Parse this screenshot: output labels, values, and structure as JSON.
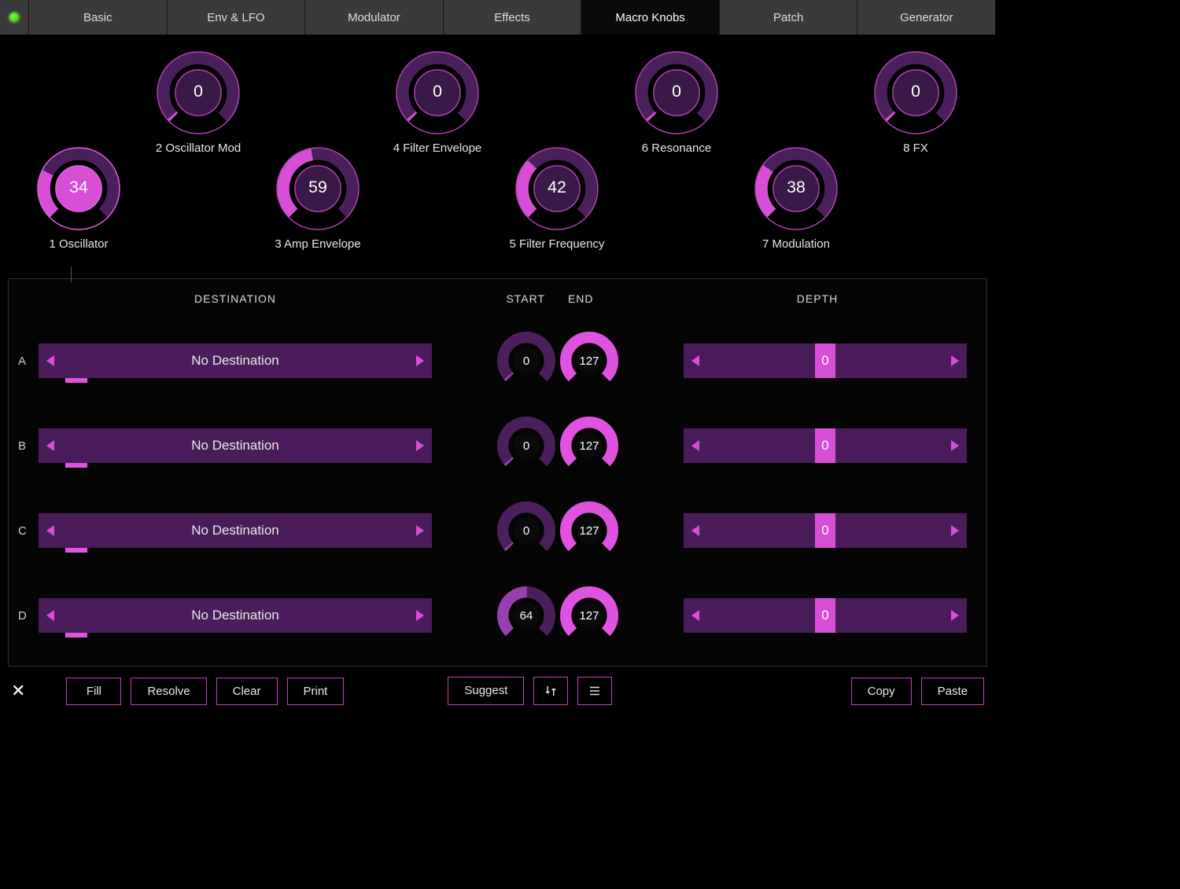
{
  "tabs": {
    "items": [
      "Basic",
      "Env & LFO",
      "Modulator",
      "Effects",
      "Macro Knobs",
      "Patch",
      "Generator"
    ],
    "active_index": 4
  },
  "knobs": [
    {
      "index": 1,
      "label": "1 Oscillator",
      "value": 34,
      "row": "bottom",
      "col": 0,
      "active": true
    },
    {
      "index": 2,
      "label": "2 Oscillator Mod",
      "value": 0,
      "row": "top",
      "col": 1
    },
    {
      "index": 3,
      "label": "3 Amp Envelope",
      "value": 59,
      "row": "bottom",
      "col": 2
    },
    {
      "index": 4,
      "label": "4 Filter Envelope",
      "value": 0,
      "row": "top",
      "col": 3
    },
    {
      "index": 5,
      "label": "5 Filter Frequency",
      "value": 42,
      "row": "bottom",
      "col": 4
    },
    {
      "index": 6,
      "label": "6 Resonance",
      "value": 0,
      "row": "top",
      "col": 5
    },
    {
      "index": 7,
      "label": "7 Modulation",
      "value": 38,
      "row": "bottom",
      "col": 6
    },
    {
      "index": 8,
      "label": "8 FX",
      "value": 0,
      "row": "top",
      "col": 7
    }
  ],
  "dest_headers": {
    "dest": "DESTINATION",
    "start": "START",
    "end": "END",
    "depth": "DEPTH"
  },
  "dest_rows": [
    {
      "letter": "A",
      "destination": "No Destination",
      "start": 0,
      "end": 127,
      "depth": 0
    },
    {
      "letter": "B",
      "destination": "No Destination",
      "start": 0,
      "end": 127,
      "depth": 0
    },
    {
      "letter": "C",
      "destination": "No Destination",
      "start": 0,
      "end": 127,
      "depth": 0
    },
    {
      "letter": "D",
      "destination": "No Destination",
      "start": 64,
      "end": 127,
      "depth": 0
    }
  ],
  "buttons": {
    "fill": "Fill",
    "resolve": "Resolve",
    "clear": "Clear",
    "print": "Print",
    "suggest": "Suggest",
    "copy": "Copy",
    "paste": "Paste"
  },
  "colors": {
    "accent": "#d64fd6",
    "accent_dark": "#7a2a8a",
    "panel": "#4a1d5a"
  }
}
